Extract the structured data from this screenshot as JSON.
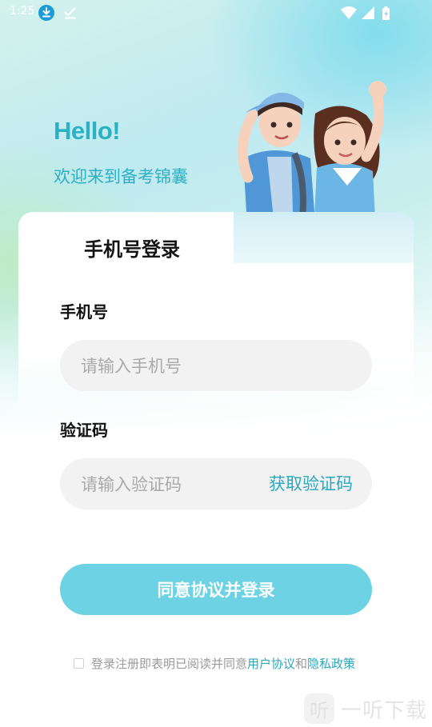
{
  "status_bar": {
    "time": "1:25",
    "icons": [
      "download-icon",
      "check-icon",
      "wifi-icon",
      "signal-icon",
      "battery-icon"
    ]
  },
  "hero": {
    "greeting": "Hello!",
    "subtitle": "欢迎来到备考锦囊",
    "illustration": "student-couple-illustration"
  },
  "login": {
    "tab_title": "手机号登录",
    "phone": {
      "label": "手机号",
      "placeholder": "请输入手机号",
      "value": ""
    },
    "code": {
      "label": "验证码",
      "placeholder": "请输入验证码",
      "value": "",
      "get_code_label": "获取验证码"
    },
    "submit_label": "同意协议并登录"
  },
  "agreement": {
    "checked": false,
    "text": "登录注册即表明已阅读并同意",
    "user_agreement": "用户协议",
    "and": "和",
    "privacy_policy": "隐私政策"
  },
  "watermark": {
    "logo_char": "听",
    "text": "一听下载"
  },
  "colors": {
    "accent": "#2bb0c4",
    "button": "#6dd3e4",
    "input_bg": "#f2f2f2"
  }
}
